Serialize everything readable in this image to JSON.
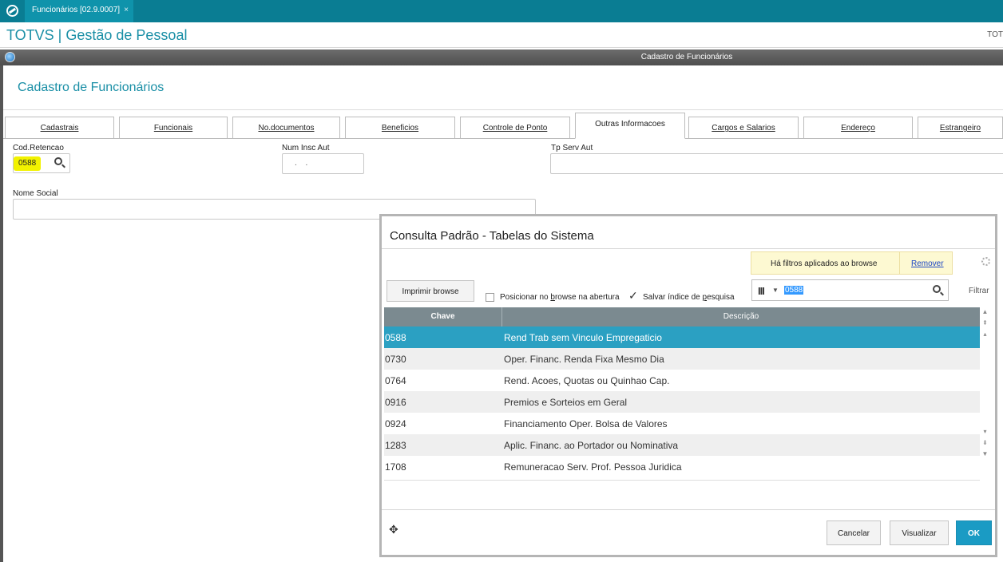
{
  "tab": {
    "title": "Funcionários [02.9.0007]",
    "close": "×"
  },
  "header": {
    "title": "TOTVS | Gestão de Pessoal",
    "right": "TOT"
  },
  "window": {
    "title": "Cadastro de Funcionários"
  },
  "page": {
    "heading": "Cadastro de Funcionários"
  },
  "folders": [
    {
      "label": "Cadastrais",
      "active": false
    },
    {
      "label": "Funcionais",
      "active": false
    },
    {
      "label": "No.documentos",
      "active": false
    },
    {
      "label": "Beneficios",
      "active": false
    },
    {
      "label": "Controle de Ponto",
      "active": false
    },
    {
      "label": "Outras Informacoes",
      "active": true
    },
    {
      "label": "Cargos e Salarios",
      "active": false
    },
    {
      "label": "Endereço",
      "active": false
    },
    {
      "label": "Estrangeiro",
      "active": false
    }
  ],
  "form": {
    "cod_retencao_label": "Cod.Retencao",
    "cod_retencao_value": "0588",
    "num_insc_label": "Num Insc Aut",
    "num_insc_value": ". .",
    "tp_serv_label": "Tp Serv Aut",
    "nome_social_label": "Nome Social"
  },
  "dialog": {
    "title": "Consulta Padrão - Tabelas do Sistema",
    "filter_notice": "Há filtros aplicados ao browse",
    "remove_link": "Remover",
    "print_button": "Imprimir browse",
    "position_option": "Posicionar no browse na abertura",
    "position_checked": false,
    "save_index_option": "Salvar índice de pesquisa",
    "save_index_checked": true,
    "search_value": "0588",
    "filter_label": "Filtrar",
    "columns": [
      "Chave",
      "Descrição"
    ],
    "rows": [
      {
        "key": "0588",
        "desc": "Rend Trab sem Vinculo Empregaticio",
        "selected": true
      },
      {
        "key": "0730",
        "desc": "Oper. Financ. Renda Fixa Mesmo Dia",
        "selected": false
      },
      {
        "key": "0764",
        "desc": "Rend. Acoes, Quotas ou Quinhao Cap.",
        "selected": false
      },
      {
        "key": "0916",
        "desc": "Premios e Sorteios em Geral",
        "selected": false
      },
      {
        "key": "0924",
        "desc": "Financiamento Oper. Bolsa de Valores",
        "selected": false
      },
      {
        "key": "1283",
        "desc": "Aplic. Financ. ao Portador ou Nominativa",
        "selected": false
      },
      {
        "key": "1708",
        "desc": "Remuneracao Serv. Prof. Pessoa Juridica",
        "selected": false
      }
    ],
    "cancel_button": "Cancelar",
    "view_button": "Visualizar",
    "ok_button": "OK"
  },
  "colors": {
    "topbar": "#0a7d93",
    "accent": "#1a8fa6",
    "selected_row": "#2ba0c2",
    "ok": "#1a9bc4",
    "highlight": "#f2f200"
  }
}
